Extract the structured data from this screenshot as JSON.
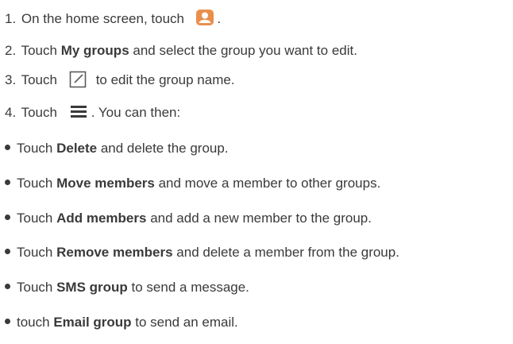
{
  "steps": [
    {
      "num": "1.",
      "text_before": " On the home screen, touch ",
      "text_after": " ."
    },
    {
      "num": "2.",
      "text_before": " Touch ",
      "bold": "My groups",
      "text_after": " and select the group you want to edit."
    },
    {
      "num": "3.",
      "text_before": " Touch ",
      "text_after": "to edit the group name."
    },
    {
      "num": "4.",
      "text_before": " Touch ",
      "text_after": ". You can then:"
    }
  ],
  "options": [
    {
      "prefix": "Touch ",
      "bold": "Delete",
      "suffix": " and delete the group."
    },
    {
      "prefix": "Touch ",
      "bold": "Move members",
      "suffix": " and move a member to other groups."
    },
    {
      "prefix": "Touch ",
      "bold": "Add members",
      "suffix": " and add a new member to the group."
    },
    {
      "prefix": "Touch ",
      "bold": "Remove members",
      "suffix": " and delete a member from the group."
    },
    {
      "prefix": "Touch ",
      "bold": "SMS group",
      "suffix": " to send a message."
    },
    {
      "prefix": "touch ",
      "bold": "Email group",
      "suffix": " to send an email."
    }
  ],
  "icons": {
    "contacts": "contacts-app-icon",
    "edit": "edit-icon",
    "menu": "menu-icon"
  },
  "colors": {
    "text": "#3a3a3a",
    "contacts_icon_bg": "#e98f4c"
  }
}
